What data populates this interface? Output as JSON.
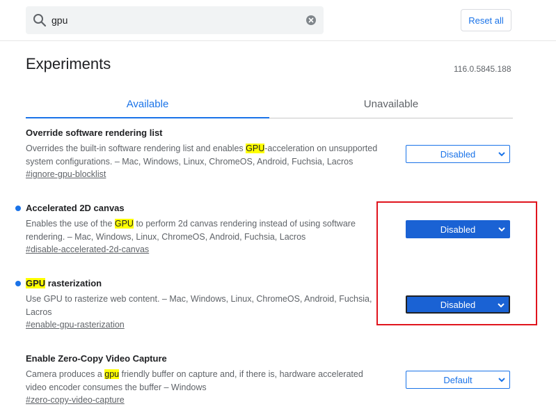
{
  "header": {
    "search_value": "gpu",
    "reset_label": "Reset all"
  },
  "page": {
    "title": "Experiments",
    "version": "116.0.5845.188"
  },
  "tabs": [
    {
      "label": "Available"
    },
    {
      "label": "Unavailable"
    }
  ],
  "experiments": [
    {
      "title": "Override software rendering list",
      "desc_pre": "Overrides the built-in software rendering list and enables ",
      "desc_hl": "GPU",
      "desc_post": "-acceleration on unsupported system configurations. – Mac, Windows, Linux, ChromeOS, Android, Fuchsia, Lacros",
      "link": "#ignore-gpu-blocklist",
      "select": "Disabled"
    },
    {
      "title": "Accelerated 2D canvas",
      "desc_pre": "Enables the use of the ",
      "desc_hl": "GPU",
      "desc_post": " to perform 2d canvas rendering instead of using software rendering. – Mac, Windows, Linux, ChromeOS, Android, Fuchsia, Lacros",
      "link": "#disable-accelerated-2d-canvas",
      "select": "Disabled"
    },
    {
      "title_hl": "GPU",
      "title_post": " rasterization",
      "desc": "Use GPU to rasterize web content. – Mac, Windows, Linux, ChromeOS, Android, Fuchsia, Lacros",
      "link": "#enable-gpu-rasterization",
      "select": "Disabled"
    },
    {
      "title": "Enable Zero-Copy Video Capture",
      "desc_pre": "Camera produces a ",
      "desc_hl": "gpu",
      "desc_post": " friendly buffer on capture and, if there is, hardware accelerated video encoder consumes the buffer – Windows",
      "link": "#zero-copy-video-capture",
      "select": "Default"
    }
  ],
  "colors": {
    "accent": "#1a73e8",
    "search_highlight": "#ffff00",
    "annotation_box": "#e0141d"
  },
  "icons": {
    "search": "search-icon",
    "clear": "clear-icon",
    "dropdown": "chevron-down-icon"
  }
}
